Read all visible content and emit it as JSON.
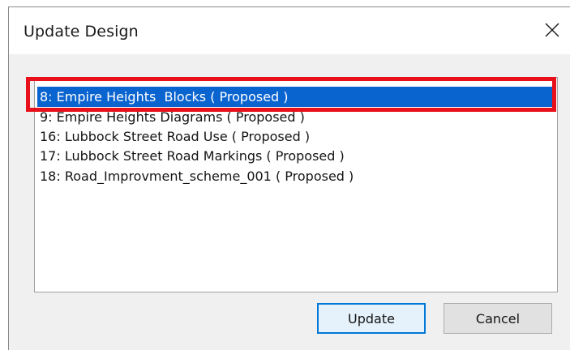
{
  "dialog": {
    "title": "Update Design",
    "close_glyph": "✕"
  },
  "list": {
    "items": [
      {
        "label": "8: Empire Heights  Blocks ( Proposed )",
        "selected": true
      },
      {
        "label": "9: Empire Heights Diagrams ( Proposed )",
        "selected": false
      },
      {
        "label": "16: Lubbock Street Road Use ( Proposed )",
        "selected": false
      },
      {
        "label": "17: Lubbock Street Road Markings ( Proposed )",
        "selected": false
      },
      {
        "label": "18: Road_Improvment_scheme_001 ( Proposed )",
        "selected": false
      }
    ],
    "selection_color": "#0a64d0",
    "annotation_color": "#e8101a"
  },
  "buttons": {
    "update_label": "Update",
    "cancel_label": "Cancel"
  }
}
